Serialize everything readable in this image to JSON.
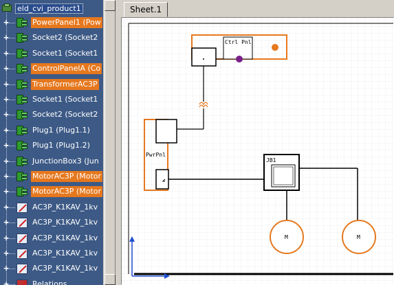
{
  "tree": {
    "root_label": "eld_cvi_product1",
    "items": [
      {
        "label": "PowerPanel1 (Pow",
        "icon": "component-icon",
        "highlighted": true
      },
      {
        "label": "Socket2 (Socket2",
        "icon": "component-icon",
        "highlighted": false
      },
      {
        "label": "Socket1 (Socket1",
        "icon": "component-icon",
        "highlighted": false
      },
      {
        "label": "ControlPanelA (Co",
        "icon": "component-icon",
        "highlighted": true
      },
      {
        "label": "TransformerAC3P",
        "icon": "component-icon",
        "highlighted": true
      },
      {
        "label": "Socket1 (Socket1",
        "icon": "component-icon",
        "highlighted": false
      },
      {
        "label": "Socket2 (Socket2",
        "icon": "component-icon",
        "highlighted": false
      },
      {
        "label": "Plug1 (Plug1.1)",
        "icon": "component-icon",
        "highlighted": false
      },
      {
        "label": "Plug1 (Plug1.2)",
        "icon": "component-icon",
        "highlighted": false
      },
      {
        "label": "JunctionBox3 (Jun",
        "icon": "component-icon",
        "highlighted": false
      },
      {
        "label": "MotorAC3P (Motor",
        "icon": "component-icon",
        "highlighted": true
      },
      {
        "label": "MotorAC3P (Motor",
        "icon": "component-icon",
        "highlighted": true
      },
      {
        "label": "AC3P_K1KAV_1kv",
        "icon": "wire-icon",
        "highlighted": false
      },
      {
        "label": "AC3P_K1KAV_1kv",
        "icon": "wire-icon",
        "highlighted": false
      },
      {
        "label": "AC3P_K1KAV_1kv",
        "icon": "wire-icon",
        "highlighted": false
      },
      {
        "label": "AC3P_K1KAV_1kv",
        "icon": "wire-icon",
        "highlighted": false
      },
      {
        "label": "AC3P_K1KAV_1kv",
        "icon": "wire-icon",
        "highlighted": false
      },
      {
        "label": "Relations",
        "icon": "relations-icon",
        "highlighted": false
      }
    ]
  },
  "sheet": {
    "tab_label": "Sheet.1",
    "labels": {
      "ctrl_panel": "Ctrl Pnl",
      "power_panel": "PwrPnl",
      "junction_box": "JB1",
      "motor_1": "M",
      "motor_2": "M"
    }
  },
  "colors": {
    "highlight": "#e6781e",
    "tree_bg": "#3d5a86",
    "component_outline": "#e6781e",
    "connector_dot": "#7a1f8a",
    "axis": "#1f4fd0"
  }
}
